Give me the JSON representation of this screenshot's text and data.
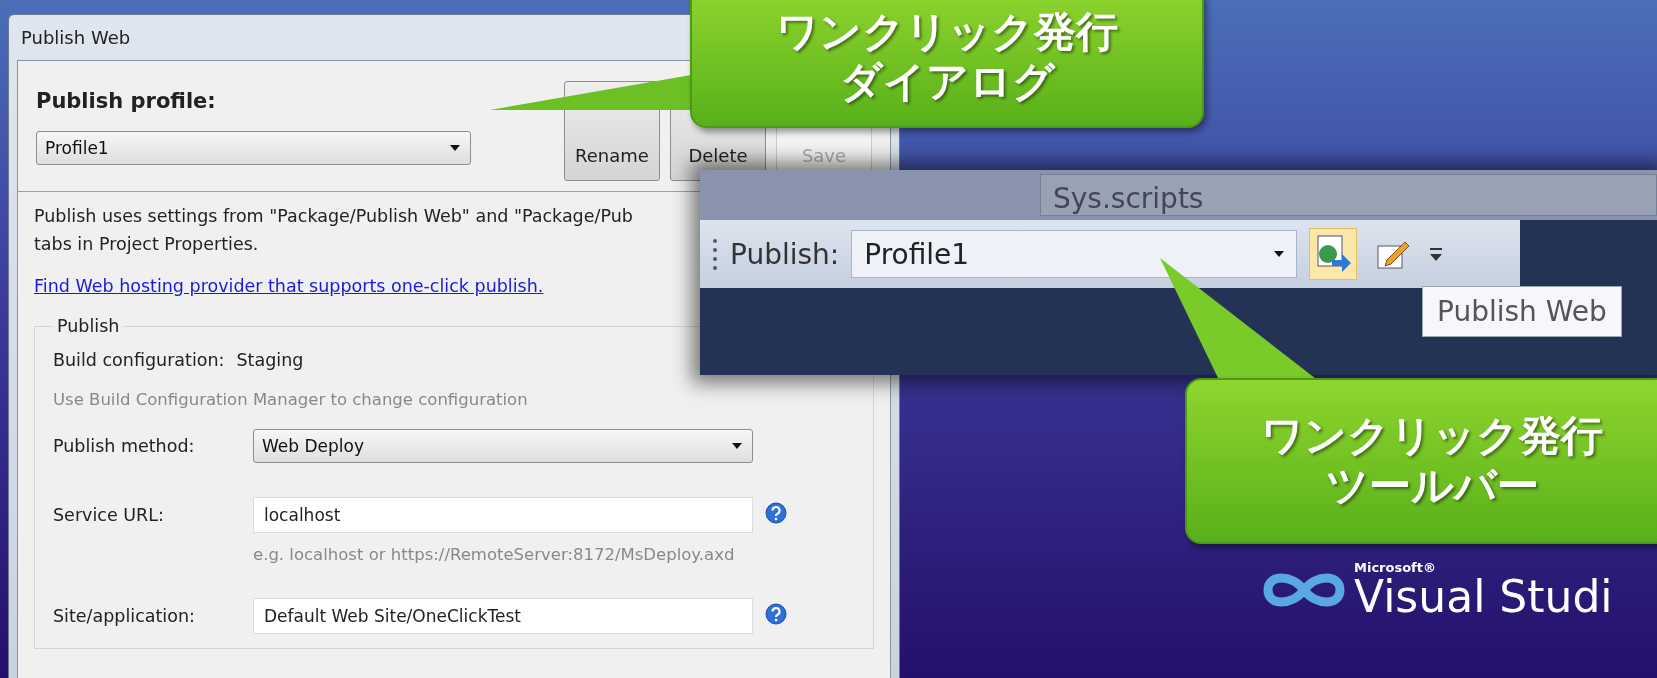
{
  "dialog": {
    "title": "Publish Web",
    "profile_label": "Publish profile:",
    "profile_value": "Profile1",
    "buttons": [
      {
        "label": "Rename",
        "disabled": false
      },
      {
        "label": "Delete",
        "disabled": false
      },
      {
        "label": "Save",
        "disabled": true
      }
    ],
    "info_lines": [
      "Publish uses settings from \"Package/Publish Web\" and \"Package/Pub",
      "tabs in Project Properties."
    ],
    "link": "Find Web hosting provider that supports one-click publish.",
    "group_label": "Publish",
    "build_label": "Build configuration:",
    "build_value": "Staging",
    "build_hint": "Use Build Configuration Manager to change configuration",
    "fields": [
      {
        "kind": "dropdown",
        "label": "Publish method:",
        "value": "Web Deploy",
        "help": false
      },
      {
        "kind": "text",
        "label": "Service URL:",
        "value": "localhost",
        "help": true,
        "hint": "e.g. localhost or https://RemoteServer:8172/MsDeploy.axd"
      },
      {
        "kind": "text",
        "label": "Site/application:",
        "value": "Default Web Site/OneClickTest",
        "help": true
      }
    ]
  },
  "toolbar": {
    "upper_field": "Sys.scripts",
    "label": "Publish:",
    "profile": "Profile1",
    "tooltip": "Publish Web"
  },
  "callouts": [
    {
      "lines": [
        "ワンクリック発行",
        "ダイアログ"
      ]
    },
    {
      "lines": [
        "ワンクリック発行",
        "ツールバー"
      ]
    }
  ],
  "logo": {
    "brand": "Microsoft®",
    "product": "Visual Studi"
  }
}
